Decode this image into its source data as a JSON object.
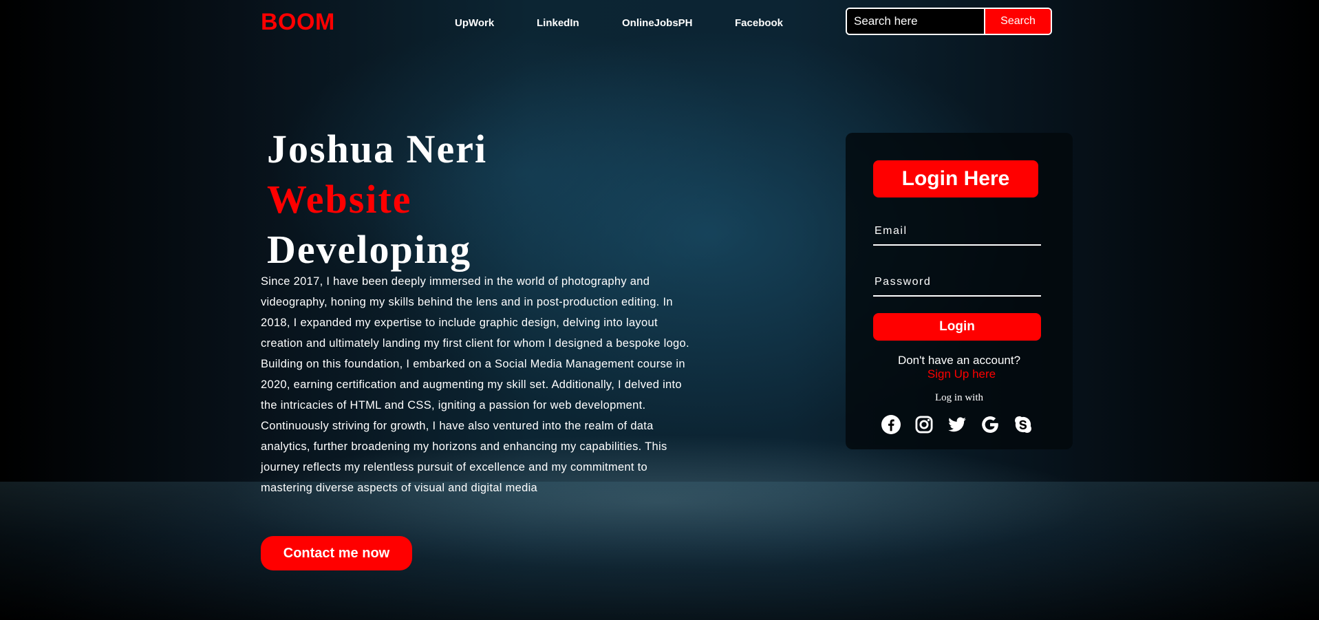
{
  "header": {
    "logo": "BOOM",
    "nav": [
      "UpWork",
      "LinkedIn",
      "OnlineJobsPH",
      "Facebook"
    ],
    "search": {
      "placeholder": "Search here",
      "button": "Search"
    }
  },
  "hero": {
    "line1": "Joshua Neri",
    "line2": "Website",
    "line3": "Developing",
    "about": "Since 2017, I have been deeply immersed in the world of photography and videography, honing my skills behind the lens and in post-production editing. In 2018, I expanded my expertise to include graphic design, delving into layout creation and ultimately landing my first client for whom I designed a bespoke logo. Building on this foundation, I embarked on a Social Media Management course in 2020, earning certification and augmenting my skill set. Additionally, I delved into the intricacies of HTML and CSS, igniting a passion for web development. Continuously striving for growth, I have also ventured into the realm of data analytics, further broadening my horizons and enhancing my capabilities. This journey reflects my relentless pursuit of excellence and my commitment to mastering diverse aspects of visual and digital media",
    "contact_button": "Contact me now"
  },
  "login": {
    "title": "Login Here",
    "email_placeholder": "Email",
    "password_placeholder": "Password",
    "button": "Login",
    "signup_question": "Don't have an account?",
    "signup_link": "Sign Up here",
    "login_with": "Log in with",
    "social_icons": [
      "facebook-icon",
      "instagram-icon",
      "twitter-icon",
      "google-icon",
      "skype-icon"
    ]
  },
  "colors": {
    "accent": "#ff0000",
    "text": "#ffffff",
    "card_bg": "#02080c"
  }
}
